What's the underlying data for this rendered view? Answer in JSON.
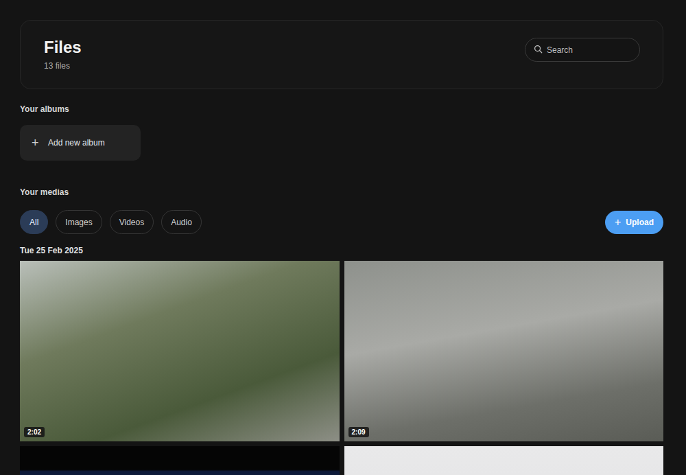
{
  "header": {
    "title": "Files",
    "count": "13 files"
  },
  "search": {
    "placeholder": "Search"
  },
  "albums": {
    "heading": "Your albums",
    "add_icon": "+",
    "add_label": "Add new album"
  },
  "medias": {
    "heading": "Your medias",
    "filters": [
      {
        "label": "All",
        "selected": true
      },
      {
        "label": "Images",
        "selected": false
      },
      {
        "label": "Videos",
        "selected": false
      },
      {
        "label": "Audio",
        "selected": false
      }
    ],
    "upload": {
      "icon": "+",
      "label": "Upload"
    }
  },
  "groups": [
    {
      "date": "Tue 25 Feb 2025",
      "items": [
        {
          "duration": "2:02"
        },
        {
          "duration": "2:09"
        },
        {},
        {}
      ]
    }
  ]
}
